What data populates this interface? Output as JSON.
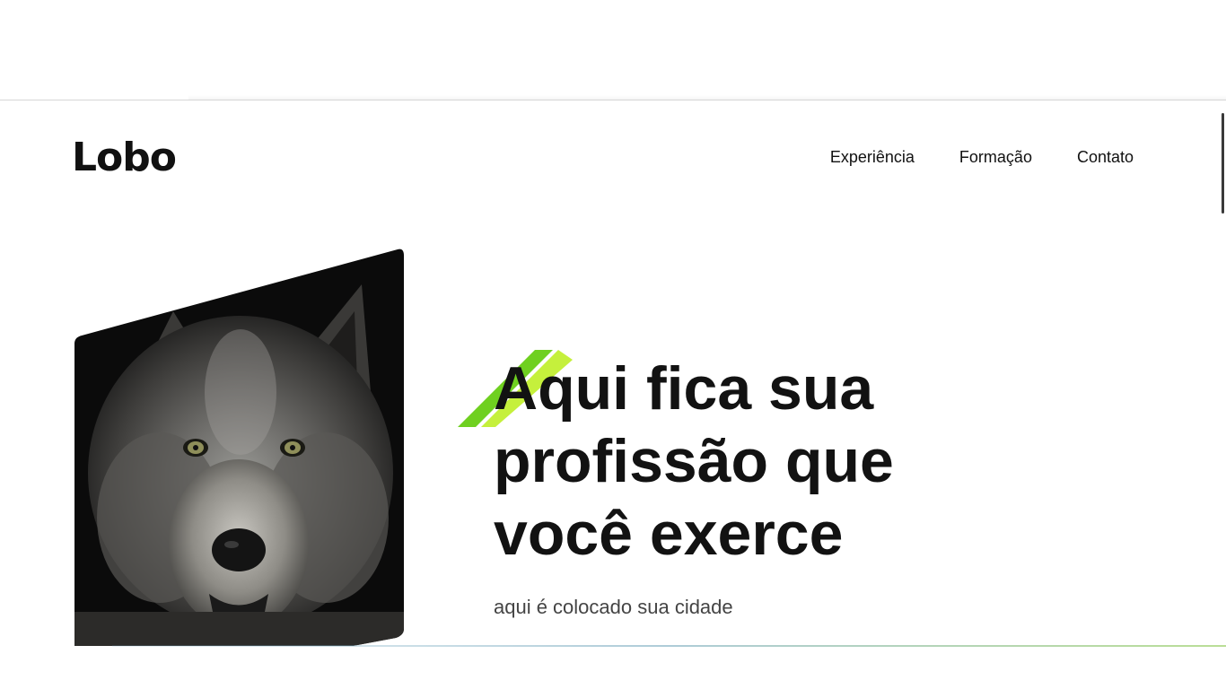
{
  "brand": {
    "logo_text": "Lobo"
  },
  "nav": {
    "items": [
      {
        "label": "Experiência"
      },
      {
        "label": "Formação"
      },
      {
        "label": "Contato"
      }
    ]
  },
  "hero": {
    "headline": "Aqui fica sua profissão que você exerce",
    "city": "aqui é colocado sua cidade",
    "image_subject": "wolf-portrait"
  },
  "colors": {
    "accent_green_dark": "#6fd020",
    "accent_green_light": "#c5f03c",
    "text": "#121212",
    "muted_text": "#444444"
  }
}
